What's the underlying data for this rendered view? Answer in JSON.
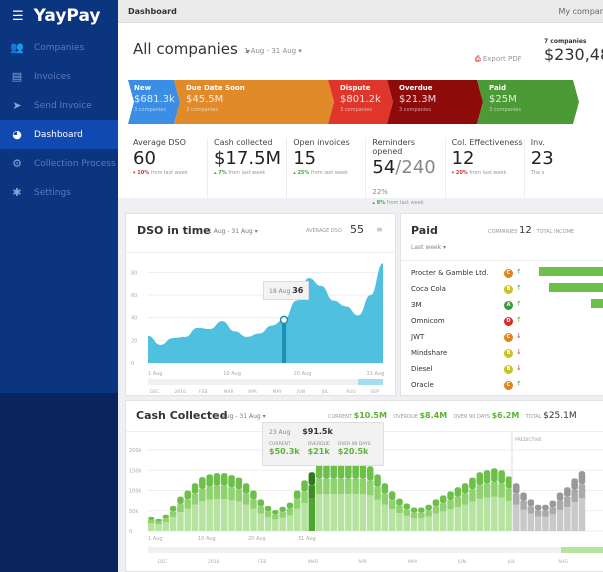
{
  "sidebar": {
    "brand": "YayPay",
    "items": [
      {
        "label": "Companies",
        "icon": "people-icon"
      },
      {
        "label": "Invoices",
        "icon": "document-icon"
      },
      {
        "label": "Send Invoice",
        "icon": "paper-plane-icon"
      },
      {
        "label": "Dashboard",
        "icon": "pie-chart-icon",
        "active": true
      },
      {
        "label": "Collection Process",
        "icon": "process-icon"
      },
      {
        "label": "Settings",
        "icon": "gear-icon"
      }
    ]
  },
  "header": {
    "title": "Dashboard",
    "right": "My compar"
  },
  "top": {
    "company": "All companies",
    "date_range": "1 Aug - 31 Aug",
    "export": "Export PDF",
    "companies_count": "7 companies",
    "total": "$230,48"
  },
  "stages": [
    {
      "name": "New",
      "value": "$681.3k",
      "count": "3 companies",
      "color": "#3a8ee6"
    },
    {
      "name": "Due Date Soon",
      "value": "$45.5M",
      "count": "3 companies",
      "color": "#e08a2a"
    },
    {
      "name": "Dispute",
      "value": "$801.2k",
      "count": "3 companies",
      "color": "#e0352b"
    },
    {
      "name": "Overdue",
      "value": "$21.3M",
      "count": "3 companies",
      "color": "#8e0b0b"
    },
    {
      "name": "Paid",
      "value": "$25M",
      "count": "3 companies",
      "color": "#4c9a36"
    }
  ],
  "metrics": [
    {
      "label": "Average DSO",
      "value": "60",
      "delta": "▾ 10%",
      "note": "from last week",
      "dir": "dn"
    },
    {
      "label": "Cash collected",
      "value": "$17.5M",
      "delta": "▴ 7%",
      "note": "from last week",
      "dir": "up"
    },
    {
      "label": "Open invoices",
      "value": "15",
      "delta": "▴ 25%",
      "note": "from last week",
      "dir": "up"
    },
    {
      "label": "Reminders opened",
      "value": "54",
      "value2": "/240",
      "pct": "22%",
      "delta": "▴ 9%",
      "note": "from last week",
      "dir": "up"
    },
    {
      "label": "Col. Effectiveness",
      "value": "12",
      "delta": "▾ 20%",
      "note": "from last week",
      "dir": "dn"
    },
    {
      "label": "Inv.",
      "value": "23",
      "delta": "",
      "note": "The s",
      "dir": "up"
    }
  ],
  "dso": {
    "title": "DSO in time",
    "range": "1 Aug - 31 Aug",
    "avg_label": "AVERAGE DSO",
    "avg": "55",
    "tooltip_date": "18 Aug",
    "tooltip_value": "36",
    "months": [
      "DEC",
      "2016",
      "FEB",
      "MAR",
      "APR",
      "MAY",
      "JUN",
      "JUL",
      "AUG",
      "SEP"
    ]
  },
  "paid": {
    "title": "Paid",
    "period": "Last week",
    "companies_label": "COMPANIES",
    "companies": "12",
    "income_label": "TOTAL INCOME",
    "rows": [
      {
        "name": "Procter & Gamble Ltd.",
        "grade": "C",
        "trend": "up",
        "bar": 0.9
      },
      {
        "name": "Coca Cola",
        "grade": "B",
        "trend": "up",
        "bar": 0.78
      },
      {
        "name": "3M",
        "grade": "A",
        "trend": "up",
        "bar": 0.25
      },
      {
        "name": "Omnicom",
        "grade": "D",
        "trend": "up",
        "bar": 0
      },
      {
        "name": "JWT",
        "grade": "C",
        "trend": "down",
        "bar": 0
      },
      {
        "name": "Mindshare",
        "grade": "B",
        "trend": "down",
        "bar": 0
      },
      {
        "name": "Diesel",
        "grade": "B",
        "trend": "down",
        "bar": 0
      },
      {
        "name": "Oracle",
        "grade": "C",
        "trend": "up",
        "bar": 0
      }
    ]
  },
  "cash": {
    "title": "Cash Collected",
    "range": "1 Aug - 31 Aug",
    "current_label": "CURRENT",
    "current": "$10.5M",
    "overdue_label": "OVERDUE",
    "overdue": "$8.4M",
    "over90_label": "OVER 90 DAYS",
    "over90": "$6.2M",
    "total_label": "TOTAL",
    "total": "$25.1M",
    "predictive": "PREDICTIVE",
    "tooltip": {
      "date": "23 Aug",
      "total": "$91.5k",
      "current": "$50.3k",
      "overdue": "$21k",
      "over90": "$20.5k"
    },
    "months": [
      "DEC",
      "2016",
      "FEB",
      "MAR",
      "APR",
      "MAY",
      "JUN",
      "JUL",
      "AUG"
    ]
  },
  "chart_data": [
    {
      "type": "area",
      "title": "DSO in time",
      "x_ticks": [
        "1 Aug",
        "10 Aug",
        "20 Aug",
        "31 Aug"
      ],
      "y_ticks": [
        0,
        20,
        40,
        60,
        80
      ],
      "ylim": [
        0,
        90
      ],
      "values": [
        24,
        16,
        22,
        23,
        31,
        30,
        37,
        28,
        23,
        26,
        33,
        38,
        55,
        75,
        68,
        55,
        50,
        42,
        60,
        88
      ],
      "highlight_index": 11
    },
    {
      "type": "bar",
      "stacked": true,
      "title": "Cash Collected",
      "x_ticks": [
        "1 Aug",
        "10 Aug",
        "20 Aug",
        "31 Aug"
      ],
      "y_ticks": [
        "0",
        "50k",
        "100k",
        "150k",
        "200k"
      ],
      "ylim": [
        0,
        210
      ],
      "split": {
        "current": 0.55,
        "overdue": 0.23,
        "over90": 0.22
      },
      "totals": [
        35,
        30,
        40,
        62,
        85,
        100,
        118,
        133,
        140,
        143,
        143,
        138,
        132,
        118,
        100,
        78,
        62,
        52,
        60,
        70,
        100,
        125,
        145,
        165,
        165,
        165,
        165,
        165,
        165,
        165,
        160,
        140,
        118,
        98,
        80,
        68,
        58,
        58,
        65,
        78,
        88,
        98,
        108,
        118,
        132,
        145,
        150,
        155,
        150,
        135
      ],
      "predictive": [
        118,
        95,
        78,
        65,
        65,
        75,
        95,
        108,
        130,
        148
      ],
      "highlight_index": 22
    }
  ]
}
